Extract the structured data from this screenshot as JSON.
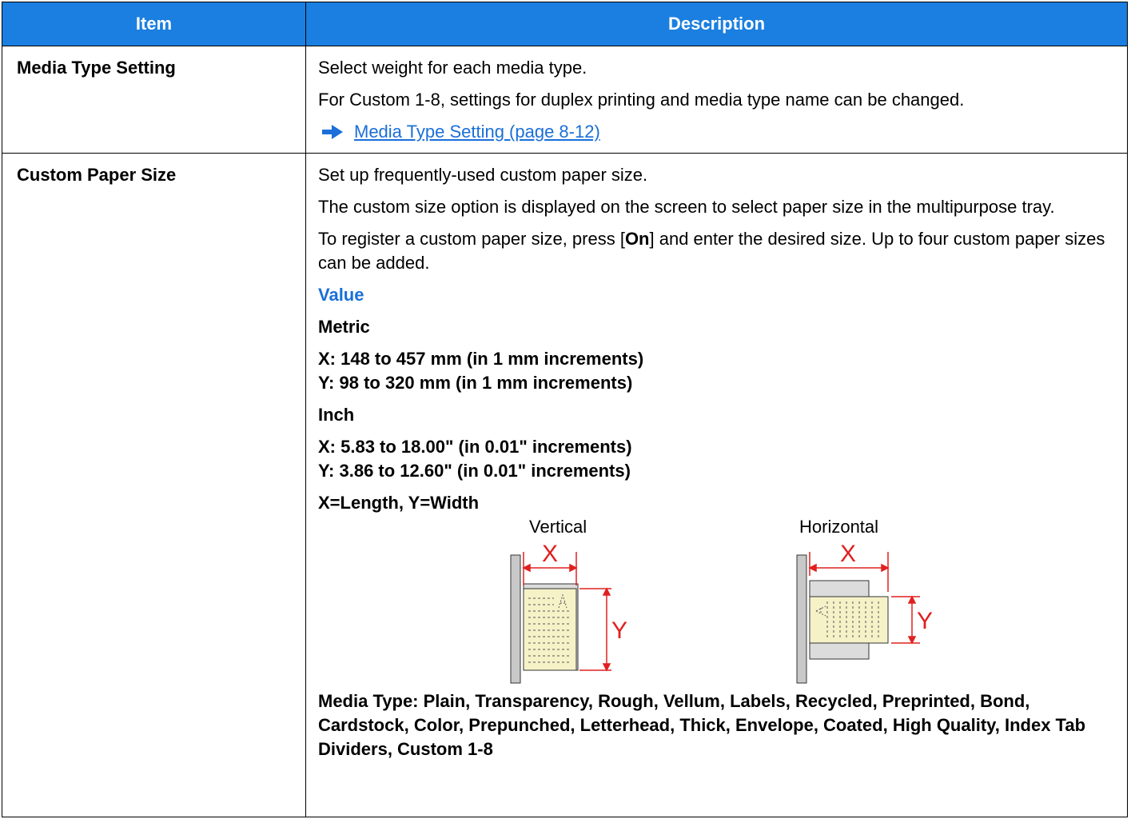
{
  "table": {
    "header": {
      "item": "Item",
      "description": "Description"
    },
    "row1": {
      "item": "Media Type Setting",
      "desc_1": "Select weight for each media type.",
      "desc_2": "For Custom 1-8, settings for duplex printing and media type name can be changed.",
      "link": "Media Type Setting (page 8-12)"
    },
    "row2": {
      "item": "Custom Paper Size",
      "desc_1": "Set up frequently-used custom paper size.",
      "desc_2": "The custom size option is displayed on the screen to select paper size in the multipurpose tray.",
      "desc_3_a": "To register a custom paper size, press [",
      "desc_3_b": "On",
      "desc_3_c": "] and enter the desired size. Up to four custom paper sizes can be added.",
      "value_heading": "Value",
      "metric_heading": "Metric",
      "metric_x": "X: 148 to 457 mm (in 1 mm increments)",
      "metric_y": "Y: 98 to 320 mm (in 1 mm increments)",
      "inch_heading": "Inch",
      "inch_x": "X: 5.83 to 18.00\" (in 0.01\" increments)",
      "inch_y": "Y: 3.86 to 12.60\" (in 0.01\" increments)",
      "xy_note": "X=Length, Y=Width",
      "fig_vertical": "Vertical",
      "fig_horizontal": "Horizontal",
      "fig_x": "X",
      "fig_y": "Y",
      "media_type": "Media Type: Plain, Transparency, Rough, Vellum, Labels, Recycled, Preprinted, Bond, Cardstock, Color, Prepunched, Letterhead, Thick, Envelope, Coated, High Quality, Index Tab Dividers, Custom 1-8"
    }
  },
  "colors": {
    "header_bg": "#1a7fe0",
    "accent": "#1a6fd8",
    "dimension_red": "#e0201f",
    "paper": "#f5f2c8"
  },
  "icons": {
    "link_arrow": "arrow-right-icon"
  }
}
